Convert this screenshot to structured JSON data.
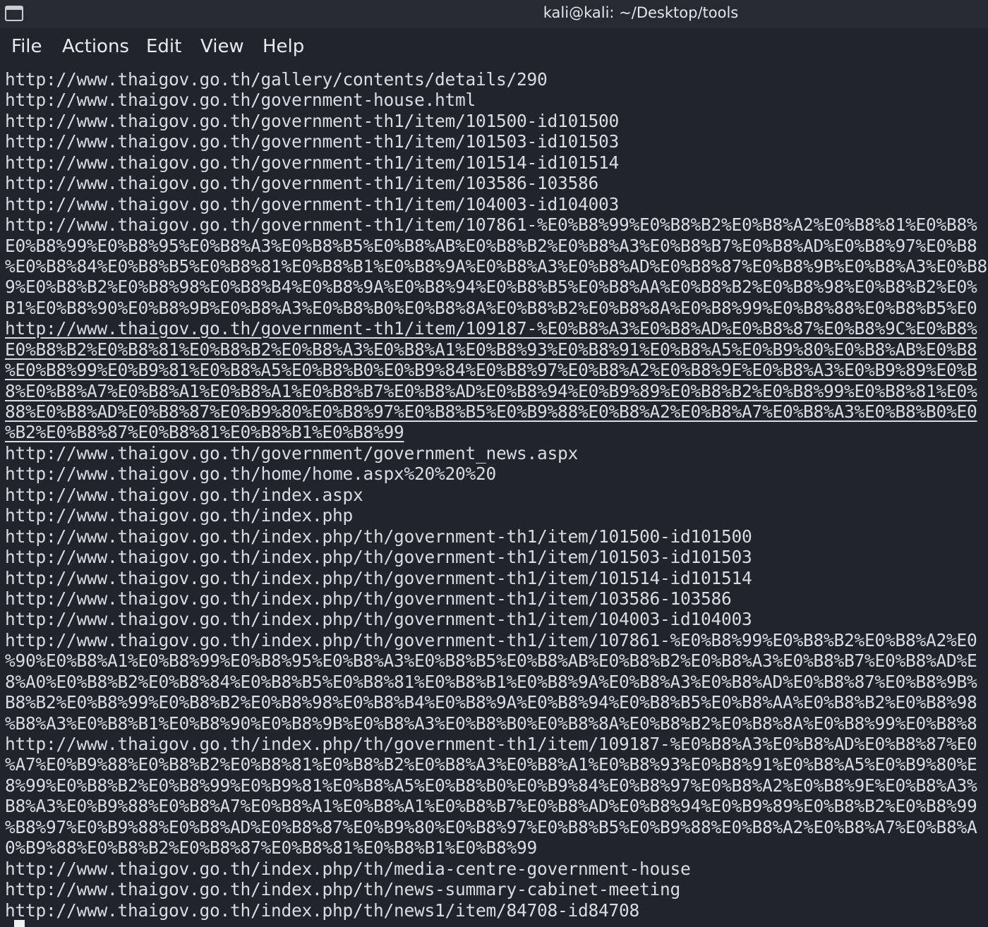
{
  "window": {
    "title": "kali@kali: ~/Desktop/tools"
  },
  "menu": [
    "File",
    "Actions",
    "Edit",
    "View",
    "Help"
  ],
  "terminal": {
    "lines": [
      {
        "text": "http://www.thaigov.go.th/gallery/contents/details/290",
        "link": false
      },
      {
        "text": "http://www.thaigov.go.th/government-house.html",
        "link": false
      },
      {
        "text": "http://www.thaigov.go.th/government-th1/item/101500-id101500",
        "link": false
      },
      {
        "text": "http://www.thaigov.go.th/government-th1/item/101503-id101503",
        "link": false
      },
      {
        "text": "http://www.thaigov.go.th/government-th1/item/101514-id101514",
        "link": false
      },
      {
        "text": "http://www.thaigov.go.th/government-th1/item/103586-103586",
        "link": false
      },
      {
        "text": "http://www.thaigov.go.th/government-th1/item/104003-id104003",
        "link": false
      },
      {
        "text": "http://www.thaigov.go.th/government-th1/item/107861-%E0%B8%99%E0%B8%B2%E0%B8%A2%E0%B8%81%E0%B8%",
        "link": false
      },
      {
        "text": "E0%B8%99%E0%B8%95%E0%B8%A3%E0%B8%B5%E0%B8%AB%E0%B8%B2%E0%B8%A3%E0%B8%B7%E0%B8%AD%E0%B8%97%E0%B8",
        "link": false
      },
      {
        "text": "%E0%B8%84%E0%B8%B5%E0%B8%81%E0%B8%B1%E0%B8%9A%E0%B8%A3%E0%B8%AD%E0%B8%87%E0%B8%9B%E0%B8%A3%E0%B8",
        "link": false
      },
      {
        "text": "9%E0%B8%B2%E0%B8%98%E0%B8%B4%E0%B8%9A%E0%B8%94%E0%B8%B5%E0%B8%AA%E0%B8%B2%E0%B8%98%E0%B8%B2%E0%",
        "link": false
      },
      {
        "text": "B1%E0%B8%90%E0%B8%9B%E0%B8%A3%E0%B8%B0%E0%B8%8A%E0%B8%B2%E0%B8%8A%E0%B8%99%E0%B8%88%E0%B8%B5%E0",
        "link": false
      },
      {
        "text": "http://www.thaigov.go.th/government-th1/item/109187-%E0%B8%A3%E0%B8%AD%E0%B8%87%E0%B8%9C%E0%B8%",
        "link": true
      },
      {
        "text": "E0%B8%B2%E0%B8%81%E0%B8%B2%E0%B8%A3%E0%B8%A1%E0%B8%93%E0%B8%91%E0%B8%A5%E0%B9%80%E0%B8%AB%E0%B8",
        "link": true
      },
      {
        "text": "%E0%B8%99%E0%B9%81%E0%B8%A5%E0%B8%B0%E0%B9%84%E0%B8%97%E0%B8%A2%E0%B8%9E%E0%B8%A3%E0%B9%89%E0%B",
        "link": true
      },
      {
        "text": "8%E0%B8%A7%E0%B8%A1%E0%B8%A1%E0%B8%B7%E0%B8%AD%E0%B8%94%E0%B9%89%E0%B8%B2%E0%B8%99%E0%B8%81%E0%",
        "link": true
      },
      {
        "text": "88%E0%B8%AD%E0%B8%87%E0%B9%80%E0%B8%97%E0%B8%B5%E0%B9%88%E0%B8%A2%E0%B8%A7%E0%B8%A3%E0%B8%B0%E0",
        "link": true
      },
      {
        "text": "%B2%E0%B8%87%E0%B8%81%E0%B8%B1%E0%B8%99",
        "link": true
      },
      {
        "text": "http://www.thaigov.go.th/government/government_news.aspx",
        "link": false
      },
      {
        "text": "http://www.thaigov.go.th/home/home.aspx%20%20%20",
        "link": false
      },
      {
        "text": "http://www.thaigov.go.th/index.aspx",
        "link": false
      },
      {
        "text": "http://www.thaigov.go.th/index.php",
        "link": false
      },
      {
        "text": "http://www.thaigov.go.th/index.php/th/government-th1/item/101500-id101500",
        "link": false
      },
      {
        "text": "http://www.thaigov.go.th/index.php/th/government-th1/item/101503-id101503",
        "link": false
      },
      {
        "text": "http://www.thaigov.go.th/index.php/th/government-th1/item/101514-id101514",
        "link": false
      },
      {
        "text": "http://www.thaigov.go.th/index.php/th/government-th1/item/103586-103586",
        "link": false
      },
      {
        "text": "http://www.thaigov.go.th/index.php/th/government-th1/item/104003-id104003",
        "link": false
      },
      {
        "text": "http://www.thaigov.go.th/index.php/th/government-th1/item/107861-%E0%B8%99%E0%B8%B2%E0%B8%A2%E0",
        "link": false
      },
      {
        "text": "%90%E0%B8%A1%E0%B8%99%E0%B8%95%E0%B8%A3%E0%B8%B5%E0%B8%AB%E0%B8%B2%E0%B8%A3%E0%B8%B7%E0%B8%AD%E",
        "link": false
      },
      {
        "text": "8%A0%E0%B8%B2%E0%B8%84%E0%B8%B5%E0%B8%81%E0%B8%B1%E0%B8%9A%E0%B8%A3%E0%B8%AD%E0%B8%87%E0%B8%9B%",
        "link": false
      },
      {
        "text": "B8%B2%E0%B8%99%E0%B8%B2%E0%B8%98%E0%B8%B4%E0%B8%9A%E0%B8%94%E0%B8%B5%E0%B8%AA%E0%B8%B2%E0%B8%98",
        "link": false
      },
      {
        "text": "%B8%A3%E0%B8%B1%E0%B8%90%E0%B8%9B%E0%B8%A3%E0%B8%B0%E0%B8%8A%E0%B8%B2%E0%B8%8A%E0%B8%99%E0%B8%8",
        "link": false
      },
      {
        "text": "http://www.thaigov.go.th/index.php/th/government-th1/item/109187-%E0%B8%A3%E0%B8%AD%E0%B8%87%E0",
        "link": false
      },
      {
        "text": "%A7%E0%B9%88%E0%B8%B2%E0%B8%81%E0%B8%B2%E0%B8%A3%E0%B8%A1%E0%B8%93%E0%B8%91%E0%B8%A5%E0%B9%80%E",
        "link": false
      },
      {
        "text": "8%99%E0%B8%B2%E0%B8%99%E0%B9%81%E0%B8%A5%E0%B8%B0%E0%B9%84%E0%B8%97%E0%B8%A2%E0%B8%9E%E0%B8%A3%",
        "link": false
      },
      {
        "text": "B8%A3%E0%B9%88%E0%B8%A7%E0%B8%A1%E0%B8%A1%E0%B8%B7%E0%B8%AD%E0%B8%94%E0%B9%89%E0%B8%B2%E0%B8%99",
        "link": false
      },
      {
        "text": "%B8%97%E0%B9%88%E0%B8%AD%E0%B8%87%E0%B9%80%E0%B8%97%E0%B8%B5%E0%B9%88%E0%B8%A2%E0%B8%A7%E0%B8%A",
        "link": false
      },
      {
        "text": "0%B9%88%E0%B8%B2%E0%B8%87%E0%B8%81%E0%B8%B1%E0%B8%99",
        "link": false
      },
      {
        "text": "http://www.thaigov.go.th/index.php/th/media-centre-government-house",
        "link": false
      },
      {
        "text": "http://www.thaigov.go.th/index.php/th/news-summary-cabinet-meeting",
        "link": false
      },
      {
        "text": "http://www.thaigov.go.th/index.php/th/news1/item/84708-id84708",
        "link": false
      }
    ]
  },
  "colors": {
    "background": "#20242c",
    "titlebar": "#262a33",
    "text": "#d9dce2"
  }
}
